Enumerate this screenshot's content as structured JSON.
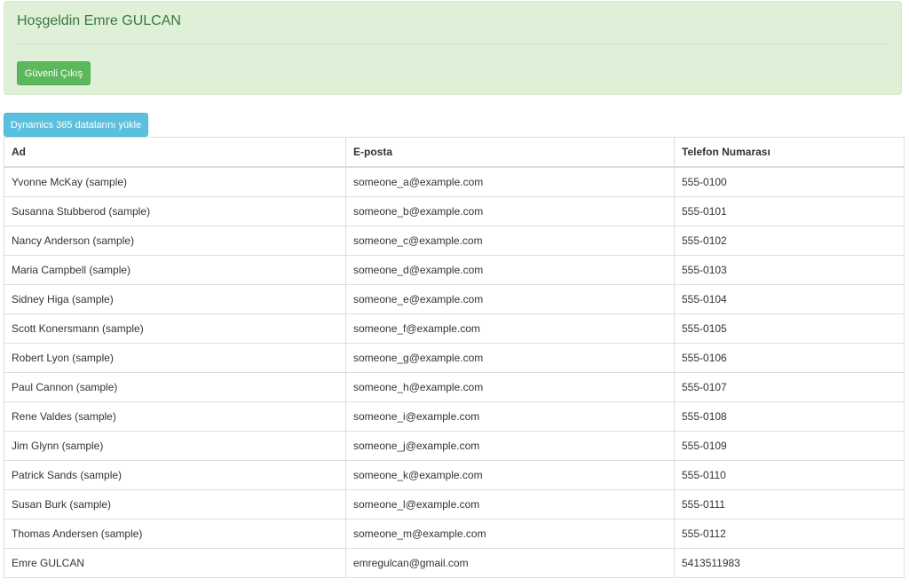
{
  "welcome": {
    "title": "Hoşgeldin Emre GULCAN",
    "logout_label": "Güvenli Çıkış"
  },
  "toolbar": {
    "load_label": "Dynamics 365 datalarını yükle"
  },
  "table": {
    "columns": [
      "Ad",
      "E-posta",
      "Telefon Numarası"
    ],
    "rows": [
      [
        "Yvonne McKay (sample)",
        "someone_a@example.com",
        "555-0100"
      ],
      [
        "Susanna Stubberod (sample)",
        "someone_b@example.com",
        "555-0101"
      ],
      [
        "Nancy Anderson (sample)",
        "someone_c@example.com",
        "555-0102"
      ],
      [
        "Maria Campbell (sample)",
        "someone_d@example.com",
        "555-0103"
      ],
      [
        "Sidney Higa (sample)",
        "someone_e@example.com",
        "555-0104"
      ],
      [
        "Scott Konersmann (sample)",
        "someone_f@example.com",
        "555-0105"
      ],
      [
        "Robert Lyon (sample)",
        "someone_g@example.com",
        "555-0106"
      ],
      [
        "Paul Cannon (sample)",
        "someone_h@example.com",
        "555-0107"
      ],
      [
        "Rene Valdes (sample)",
        "someone_i@example.com",
        "555-0108"
      ],
      [
        "Jim Glynn (sample)",
        "someone_j@example.com",
        "555-0109"
      ],
      [
        "Patrick Sands (sample)",
        "someone_k@example.com",
        "555-0110"
      ],
      [
        "Susan Burk (sample)",
        "someone_l@example.com",
        "555-0111"
      ],
      [
        "Thomas Andersen (sample)",
        "someone_m@example.com",
        "555-0112"
      ],
      [
        "Emre GULCAN",
        "emregulcan@gmail.com",
        "5413511983"
      ]
    ]
  }
}
